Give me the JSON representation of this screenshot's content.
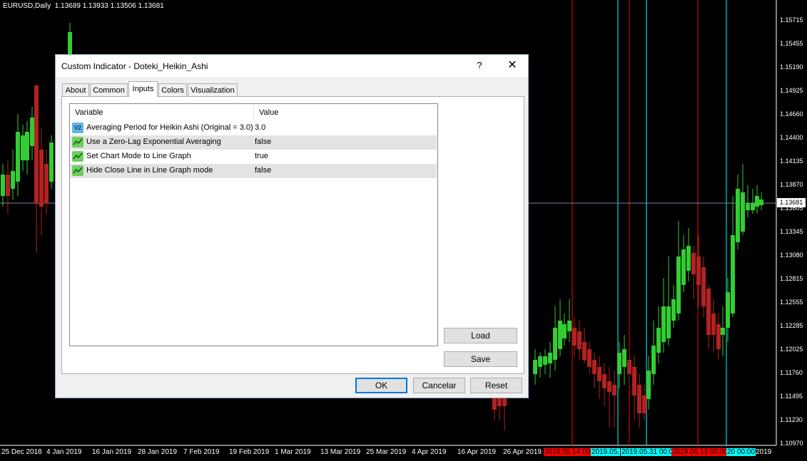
{
  "chart": {
    "title": "EURUSD,Daily  1.13689 1.13933 1.13506 1.13681",
    "current_price": "1.13681",
    "y_labels": [
      "1.15715",
      "1.15455",
      "1.15190",
      "1.14925",
      "1.14660",
      "1.14400",
      "1.14135",
      "1.13870",
      "1.13605",
      "1.13345",
      "1.13080",
      "1.12815",
      "1.12555",
      "1.12285",
      "1.12025",
      "1.11760",
      "1.11495",
      "1.11230",
      "1.10970"
    ],
    "x_labels": [
      "25 Dec 2018",
      "4 Jan 2019",
      "16 Jan 2019",
      "28 Jan 2019",
      "7 Feb 2019",
      "19 Feb 2019",
      "1 Mar 2019",
      "13 Mar 2019",
      "25 Mar 2019",
      "4 Apr 2019",
      "16 Apr 2019",
      "26 Apr 2019"
    ],
    "time_tags": [
      {
        "text": "2019.05.14 00:0",
        "color": "#ff0000"
      },
      {
        "text": "2019.05.",
        "color": "#00ffff"
      },
      {
        "text": "2019.05.31 00:0",
        "color": "#00ffff"
      },
      {
        "text": "2019.06.13 00:00",
        "color": "#ff0000"
      },
      {
        "text": "20 00:00",
        "color": "#00ffff"
      },
      {
        "text": "2019",
        "color": "#ffffff"
      }
    ],
    "colors": {
      "bull": "#32cd32",
      "bear": "#b22222",
      "red_line": "#ff0000",
      "cyan_line": "#00ffff",
      "crosshair": "#6f8aa8"
    }
  },
  "dialog": {
    "title": "Custom Indicator - Doteki_Heikin_Ashi",
    "help": "?",
    "close": "✕",
    "tabs": [
      {
        "label": "About",
        "active": false
      },
      {
        "label": "Common",
        "active": false
      },
      {
        "label": "Inputs",
        "active": true
      },
      {
        "label": "Colors",
        "active": false
      },
      {
        "label": "Visualization",
        "active": false
      }
    ],
    "grid": {
      "headers": {
        "variable": "Variable",
        "value": "Value"
      },
      "rows": [
        {
          "icon": "value-icon",
          "name": "Averaging Period for Heikin Ashi (Original = 3.0)",
          "value": "3.0"
        },
        {
          "icon": "boolean-icon",
          "name": "Use a Zero-Lag Exponential Averaging",
          "value": "false"
        },
        {
          "icon": "boolean-icon",
          "name": "Set Chart Mode to Line Graph",
          "value": "true"
        },
        {
          "icon": "boolean-icon",
          "name": "Hide Close Line in Line Graph mode",
          "value": "false"
        }
      ]
    },
    "buttons": {
      "load": "Load",
      "save": "Save",
      "ok": "OK",
      "cancel": "Cancelar",
      "reset": "Reset"
    },
    "value_icon_text": "V2"
  }
}
